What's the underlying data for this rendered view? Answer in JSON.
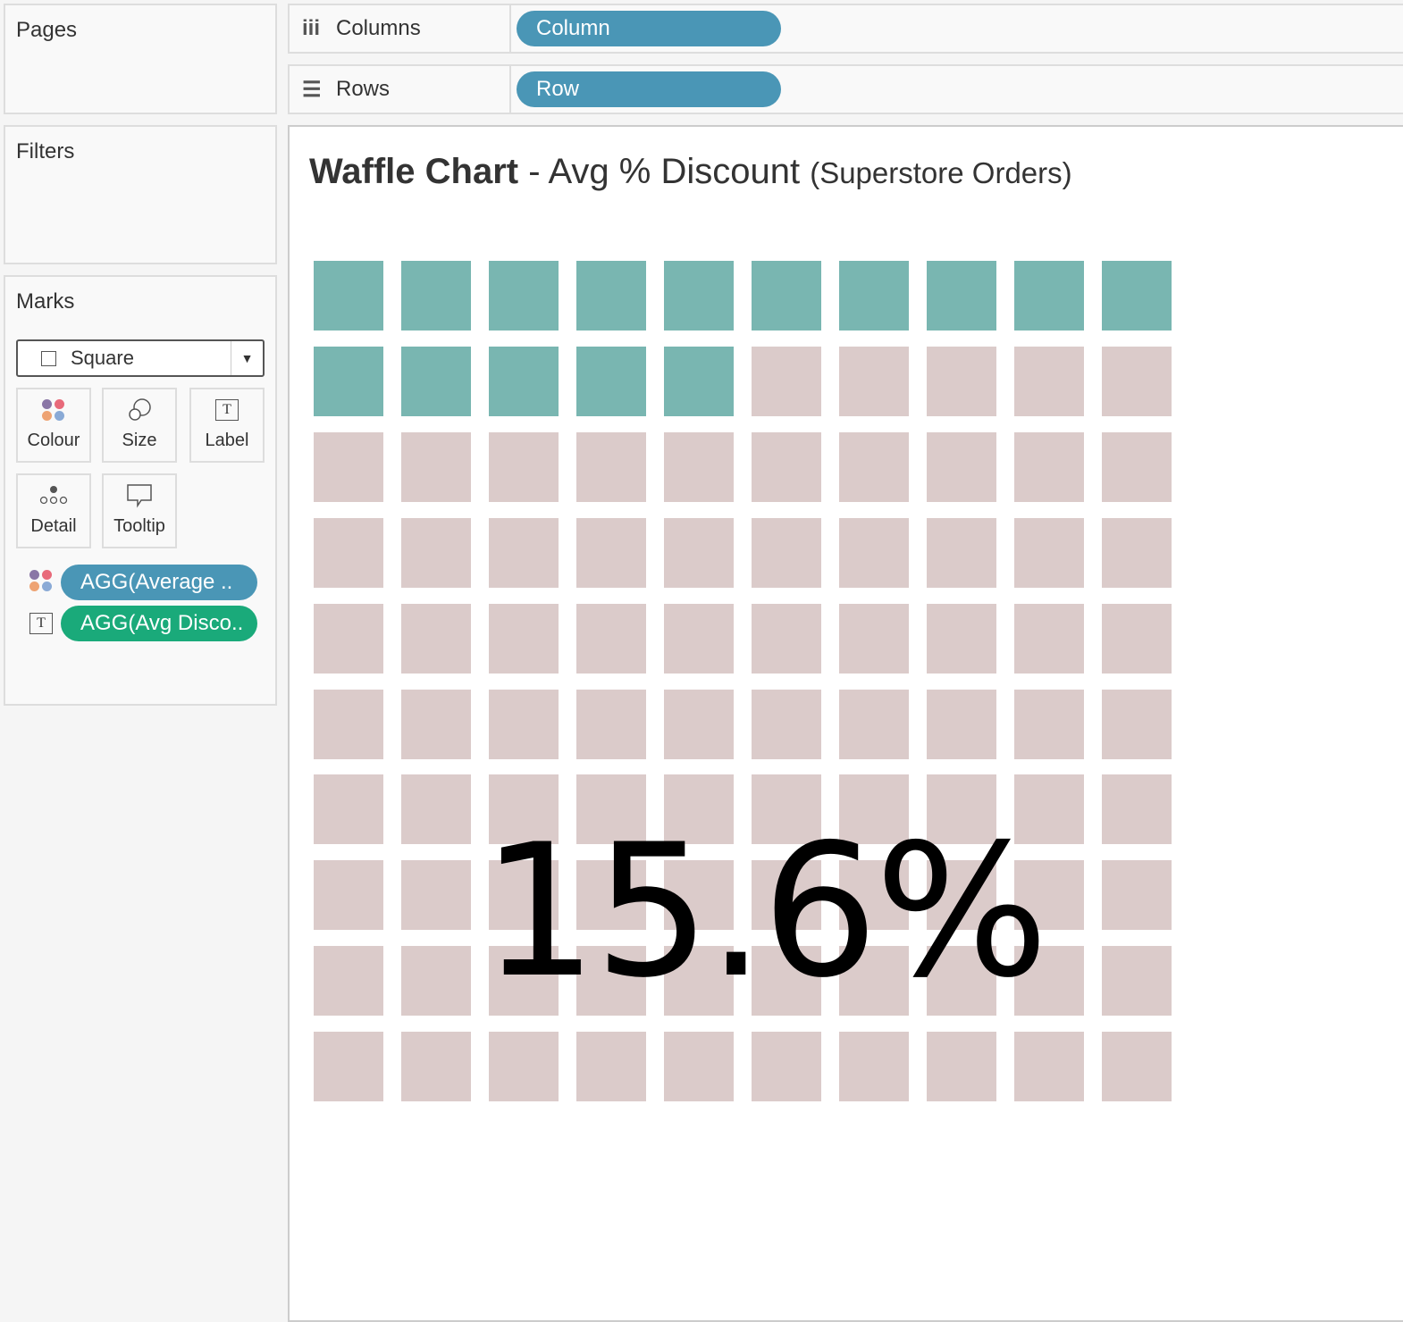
{
  "cards": {
    "pages": "Pages",
    "filters": "Filters",
    "marks": "Marks"
  },
  "shelves": {
    "columns_label": "Columns",
    "columns_pill": "Column",
    "rows_label": "Rows",
    "rows_pill": "Row"
  },
  "marks": {
    "type": "Square",
    "buttons": [
      "Colour",
      "Size",
      "Label",
      "Detail",
      "Tooltip"
    ],
    "pills": [
      "AGG(Average ..",
      "AGG(Avg Disco.."
    ]
  },
  "colors": {
    "filled": "#79b6b1",
    "empty": "#dbcbca",
    "pill_blue": "#4a96b6",
    "pill_green": "#1aaa7a"
  },
  "chart_data": {
    "type": "heatmap",
    "title": "Waffle Chart",
    "title_rest": "- Avg % Discount",
    "subtitle": "(Superstore Orders)",
    "rows": 10,
    "columns": 10,
    "value_percent": 15.6,
    "filled_cells": 15,
    "label": "15.6%"
  }
}
